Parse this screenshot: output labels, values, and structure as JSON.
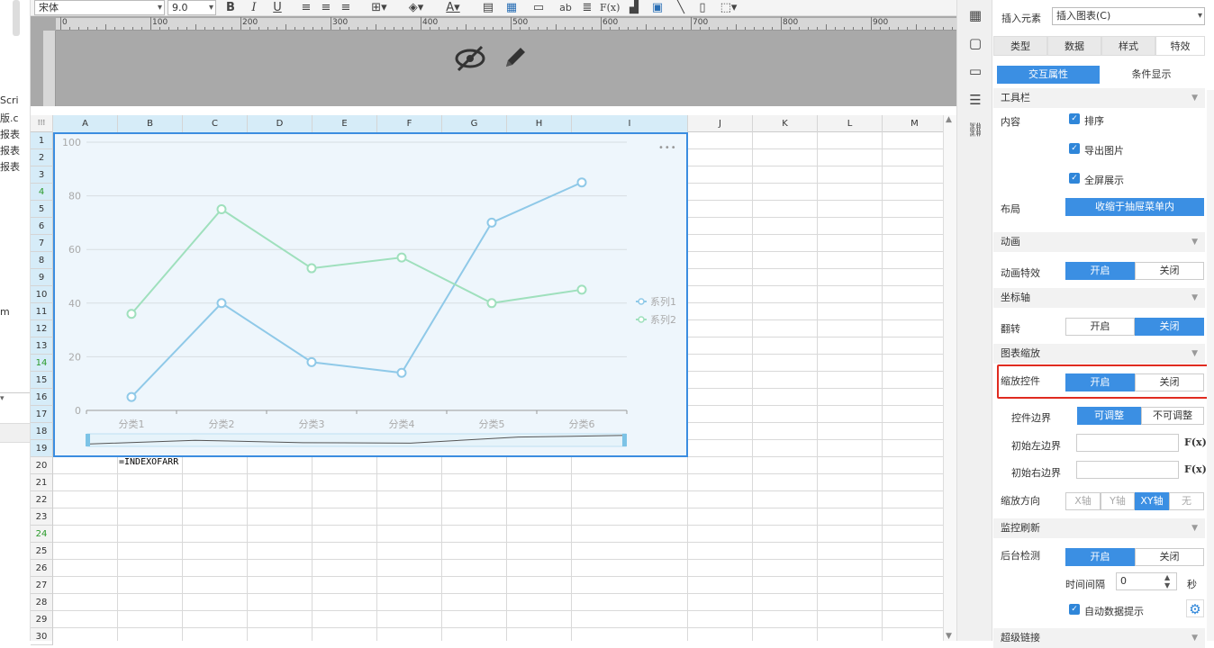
{
  "left_strip": {
    "lines": [
      "Scri",
      "版.c",
      "报表",
      "报表",
      "报表",
      "m"
    ]
  },
  "toolbar": {
    "font": "宋体",
    "size": "9.0",
    "bold": "B",
    "italic": "I",
    "underline": "U",
    "ab": "ab",
    "fx": "F(x)"
  },
  "ruler": {
    "ticks": [
      "0",
      "100",
      "200",
      "300",
      "400",
      "500",
      "600",
      "700",
      "800",
      "900",
      "1000"
    ]
  },
  "grid": {
    "columns": [
      "A",
      "B",
      "C",
      "D",
      "E",
      "F",
      "G",
      "H",
      "I",
      "J",
      "K",
      "L",
      "M"
    ],
    "rows": [
      "1",
      "2",
      "3",
      "4",
      "5",
      "6",
      "7",
      "8",
      "9",
      "10",
      "11",
      "12",
      "13",
      "14",
      "15",
      "16",
      "17",
      "18",
      "19",
      "20",
      "21",
      "22",
      "23",
      "24",
      "25",
      "26",
      "27",
      "28",
      "29",
      "30"
    ],
    "formula_cell": "=INDEXOFARR"
  },
  "chart_data": {
    "type": "line",
    "categories": [
      "分类1",
      "分类2",
      "分类3",
      "分类4",
      "分类5",
      "分类6"
    ],
    "series": [
      {
        "name": "系列1",
        "values": [
          5,
          40,
          18,
          14,
          70,
          85
        ],
        "color": "#8fc9e8"
      },
      {
        "name": "系列2",
        "values": [
          36,
          75,
          53,
          57,
          40,
          45
        ],
        "color": "#9fe0bd"
      }
    ],
    "yticks": [
      "0",
      "20",
      "40",
      "60",
      "80",
      "100"
    ],
    "ylim": [
      0,
      100
    ],
    "grid": true,
    "legend": "right",
    "zoom_slider": true,
    "more_icon": "•••"
  },
  "panel": {
    "insert_label": "插入元素",
    "insert_value": "插入图表(C)",
    "tabs": [
      "类型",
      "数据",
      "样式",
      "特效"
    ],
    "subtabs": [
      "交互属性",
      "条件显示"
    ],
    "toolbar_section": "工具栏",
    "content_label": "内容",
    "checks": [
      "排序",
      "导出图片",
      "全屏展示"
    ],
    "layout_label": "布局",
    "layout_value": "收缩于抽屉菜单内",
    "anim_section": "动画",
    "anim_label": "动画特效",
    "on": "开启",
    "off": "关闭",
    "axis_section": "坐标轴",
    "flip_label": "翻转",
    "zoom_section": "图表缩放",
    "zoom_ctrl_label": "缩放控件",
    "bound_label": "控件边界",
    "adjustable": "可调整",
    "not_adjustable": "不可调整",
    "init_left": "初始左边界",
    "init_right": "初始右边界",
    "zoom_dir_label": "缩放方向",
    "dirs": [
      "X轴",
      "Y轴",
      "XY轴",
      "无"
    ],
    "monitor_section": "监控刷新",
    "bg_check_label": "后台检测",
    "interval_label": "时间间隔",
    "interval_value": "0",
    "seconds": "秒",
    "auto_tip": "自动数据提示",
    "hyperlink_section": "超级链接",
    "fx": "F(x)"
  }
}
